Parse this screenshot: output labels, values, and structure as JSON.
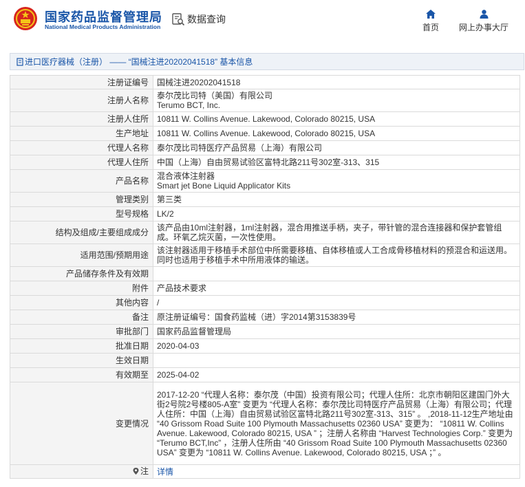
{
  "header": {
    "site_title": "国家药品监督管理局",
    "site_subtitle": "National Medical Products Administration",
    "query_label": "数据查询",
    "nav": {
      "home_label": "首页",
      "hall_label": "网上办事大厅"
    },
    "brand_color": "#1a56a8"
  },
  "breadcrumb": {
    "text": "进口医疗器械（注册） —— “国械注进20202041518” 基本信息"
  },
  "details": {
    "rows": [
      {
        "label": "注册证编号",
        "value": "国械注进20202041518"
      },
      {
        "label": "注册人名称",
        "value": "泰尔茂比司特（美国）有限公司\nTerumo BCT, Inc."
      },
      {
        "label": "注册人住所",
        "value": "10811 W. Collins Avenue. Lakewood, Colorado 80215, USA"
      },
      {
        "label": "生产地址",
        "value": "10811 W. Collins Avenue. Lakewood, Colorado 80215, USA"
      },
      {
        "label": "代理人名称",
        "value": "泰尔茂比司特医疗产品贸易（上海）有限公司"
      },
      {
        "label": "代理人住所",
        "value": "中国（上海）自由贸易试验区富特北路211号302室-313、315"
      },
      {
        "label": "产品名称",
        "value": "混合液体注射器\nSmart jet Bone Liquid Applicator Kits"
      },
      {
        "label": "管理类别",
        "value": "第三类"
      },
      {
        "label": "型号规格",
        "value": "LK/2"
      },
      {
        "label": "结构及组成/主要组成成分",
        "value": "该产品由10ml注射器，1ml注射器，混合用推送手柄，夹子，带针管的混合连接器和保护套管组成。环氧乙烷灭菌，一次性使用。"
      },
      {
        "label": "适用范围/预期用途",
        "value": "该注射器适用于移植手术部位中所需要移植、自体移植或人工合成骨移植材料的预混合和运送用。同时也适用于移植手术中所用液体的输送。"
      },
      {
        "label": "产品储存条件及有效期",
        "value": ""
      },
      {
        "label": "附件",
        "value": "产品技术要求"
      },
      {
        "label": "其他内容",
        "value": "/"
      },
      {
        "label": "备注",
        "value": "原注册证编号：国食药监械（进）字2014第3153839号"
      },
      {
        "label": "审批部门",
        "value": "国家药品监督管理局"
      },
      {
        "label": "批准日期",
        "value": "2020-04-03"
      },
      {
        "label": "生效日期",
        "value": ""
      },
      {
        "label": "有效期至",
        "value": "2025-04-02"
      },
      {
        "label": "变更情况",
        "value": "2017-12-20 “代理人名称：泰尔茂（中国）投资有限公司；代理人住所：北京市朝阳区建国门外大街2号院2号楼805-A室” 变更为 “代理人名称：泰尔茂比司特医疗产品贸易（上海）有限公司；代理人住所：中国（上海）自由贸易试验区富特北路211号302室-313、315” 。 ,2018-11-12生产地址由 “40 Grissom Road Suite 100 Plymouth Massachusetts 02360 USA” 变更为： “10811 W. Collins Avenue. Lakewood, Colorado 80215, USA ” ；注册人名称由 “Harvest Technologies Corp.” 变更为 “Terumo BCT,Inc” ，注册人住所由 “40 Grissom Road Suite 100 Plymouth Massachusetts 02360 USA” 变更为 “10811 W. Collins Avenue. Lakewood, Colorado 80215, USA ；” 。"
      }
    ],
    "note": {
      "label": "注",
      "link": "详情"
    }
  }
}
